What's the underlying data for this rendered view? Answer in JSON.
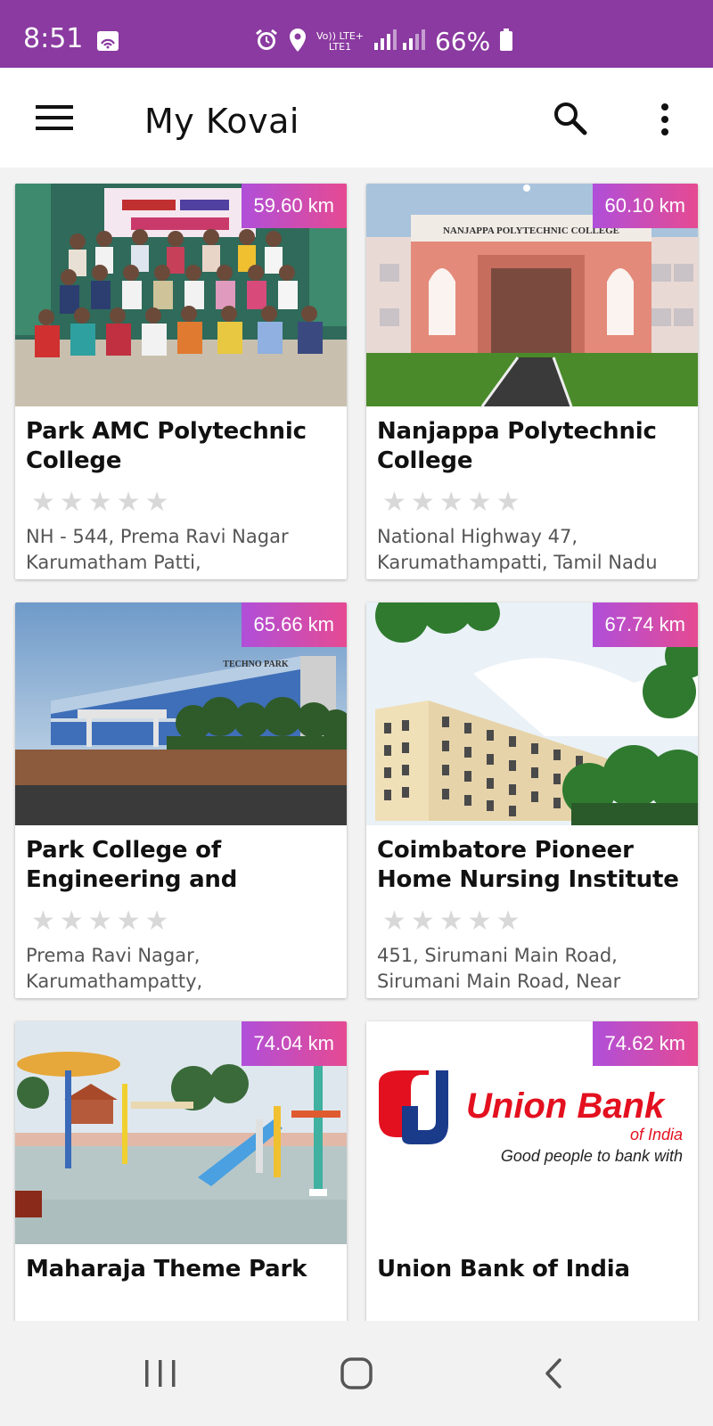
{
  "status_bar": {
    "time": "8:51",
    "network_top": "Vo)) LTE+",
    "network_bottom": "LTE1",
    "battery": "66%",
    "icons": [
      "qr-icon",
      "alarm-icon",
      "location-icon",
      "signal-icon",
      "battery-icon"
    ]
  },
  "app_bar": {
    "title": "My Kovai",
    "icons": [
      "menu-icon",
      "search-icon",
      "more-vert-icon"
    ]
  },
  "listings": [
    {
      "name": "Park AMC Polytechnic College",
      "distance": "59.60 km",
      "address": "NH - 544, Prema Ravi Nagar Karumatham Patti,",
      "rating": 0
    },
    {
      "name": "Nanjappa Polytechnic College",
      "distance": "60.10 km",
      "address": "National Highway 47, Karumathampatti, Tamil Nadu",
      "rating": 0
    },
    {
      "name": "Park College of Engineering and",
      "distance": "65.66 km",
      "address": "Prema Ravi Nagar, Karumathampatty,",
      "rating": 0
    },
    {
      "name": "Coimbatore Pioneer Home Nursing Institute",
      "distance": "67.74 km",
      "address": "451, Sirumani Main Road, Sirumani Main Road, Near",
      "rating": 0
    },
    {
      "name": "Maharaja Theme Park",
      "distance": "74.04 km",
      "address": "",
      "rating": 0
    },
    {
      "name": "Union Bank of India",
      "distance": "74.62 km",
      "address": "",
      "rating": 0
    }
  ],
  "images": {
    "banner_nanjappa": "NANJAPPA POLYTECHNIC COLLEGE",
    "banner_techno": "TECHNO PARK",
    "bank_logo_name": "Union Bank",
    "bank_logo_sub": "of India",
    "bank_tagline": "Good people to bank with"
  },
  "colors": {
    "status_bar": "#8a3aa0",
    "badge_start": "#b04fd9",
    "badge_end": "#e64a92",
    "star_empty": "#d8d8d8"
  },
  "nav_bar": {
    "icons": [
      "recents-icon",
      "home-icon",
      "back-icon"
    ]
  }
}
